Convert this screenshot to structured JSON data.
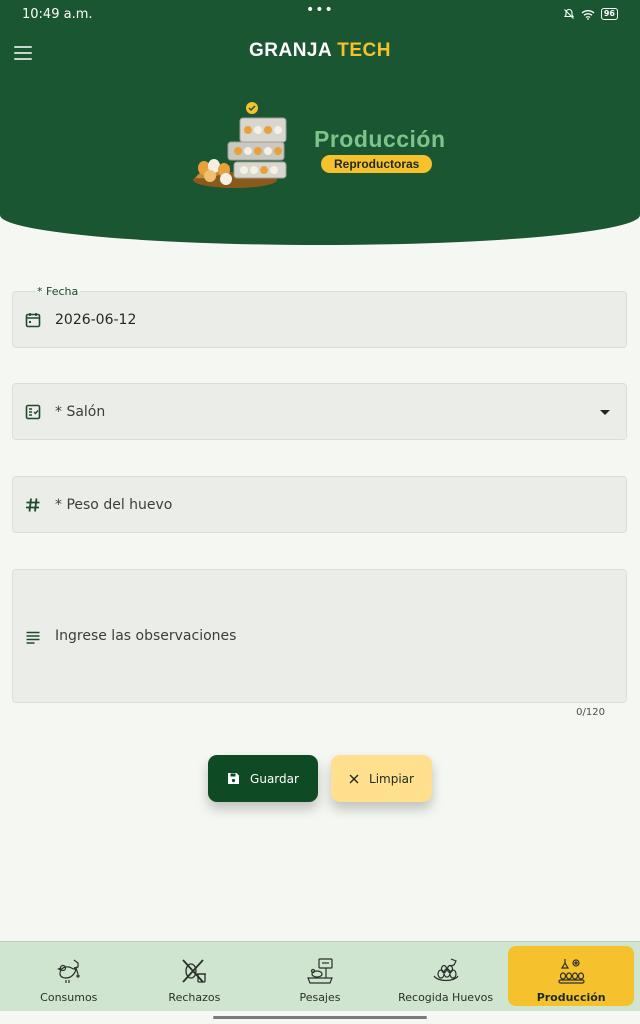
{
  "status_bar": {
    "time": "10:49 a.m.",
    "battery": "96"
  },
  "header": {
    "brand_primary": "GRANJA",
    "brand_secondary": "TECH",
    "title": "Producción",
    "subtitle": "Reproductoras"
  },
  "form": {
    "fecha": {
      "label": "* Fecha",
      "value": "2026-06-12",
      "icon": "calendar-icon"
    },
    "salon": {
      "placeholder": "* Salón",
      "icon": "checklist-icon"
    },
    "peso": {
      "placeholder": "* Peso del huevo",
      "icon": "hash-icon"
    },
    "observaciones": {
      "placeholder": "Ingrese las observaciones",
      "icon": "notes-icon",
      "counter": "0/120"
    }
  },
  "actions": {
    "save_label": "Guardar",
    "clear_label": "Limpiar"
  },
  "bottom_nav": {
    "items": [
      {
        "label": "Consumos",
        "icon": "hen-feed-icon"
      },
      {
        "label": "Rechazos",
        "icon": "reject-icon"
      },
      {
        "label": "Pesajes",
        "icon": "scale-icon"
      },
      {
        "label": "Recogida Huevos",
        "icon": "egg-collect-icon"
      },
      {
        "label": "Producción",
        "icon": "production-icon",
        "active": true
      }
    ]
  },
  "colors": {
    "primary": "#1b5632",
    "accent": "#f5c22e",
    "background": "#f5f7f2",
    "nav": "#cfe5cf"
  }
}
